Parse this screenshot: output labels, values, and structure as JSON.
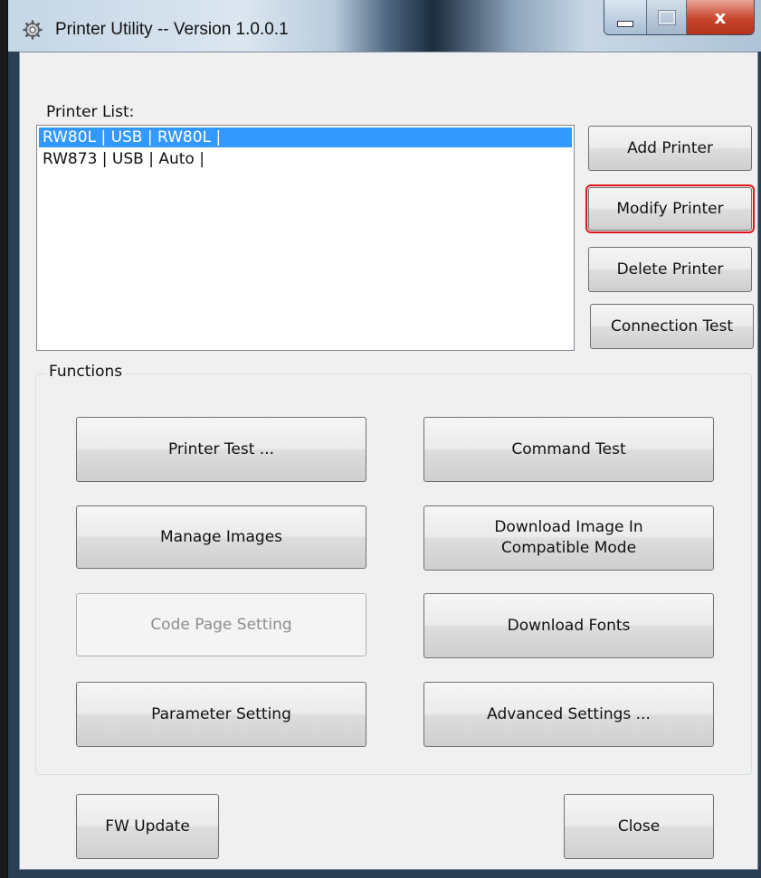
{
  "window": {
    "title": "Printer Utility -- Version 1.0.0.1",
    "close_glyph": "x"
  },
  "printer_list": {
    "label": "Printer List:",
    "items": [
      {
        "label": "RW80L | USB | RW80L |",
        "selected": true
      },
      {
        "label": "RW873 | USB | Auto |",
        "selected": false
      }
    ]
  },
  "side_buttons": {
    "add": "Add Printer",
    "modify": "Modify Printer",
    "delete": "Delete Printer",
    "connection_test": "Connection Test"
  },
  "functions": {
    "title": "Functions",
    "printer_test": "Printer Test ...",
    "command_test": "Command Test",
    "manage_images": "Manage Images",
    "download_image_line1": "Download Image In",
    "download_image_line2": "Compatible Mode",
    "code_page": "Code Page Setting",
    "download_fonts": "Download Fonts",
    "parameter_setting": "Parameter Setting",
    "advanced_settings": "Advanced Settings ..."
  },
  "bottom": {
    "fw_update": "FW Update",
    "close": "Close"
  },
  "colors": {
    "selection": "#3399ff",
    "highlight_outline": "#e0141a",
    "close_button": "#c9462c"
  },
  "icons": {
    "app": "gear-icon"
  }
}
